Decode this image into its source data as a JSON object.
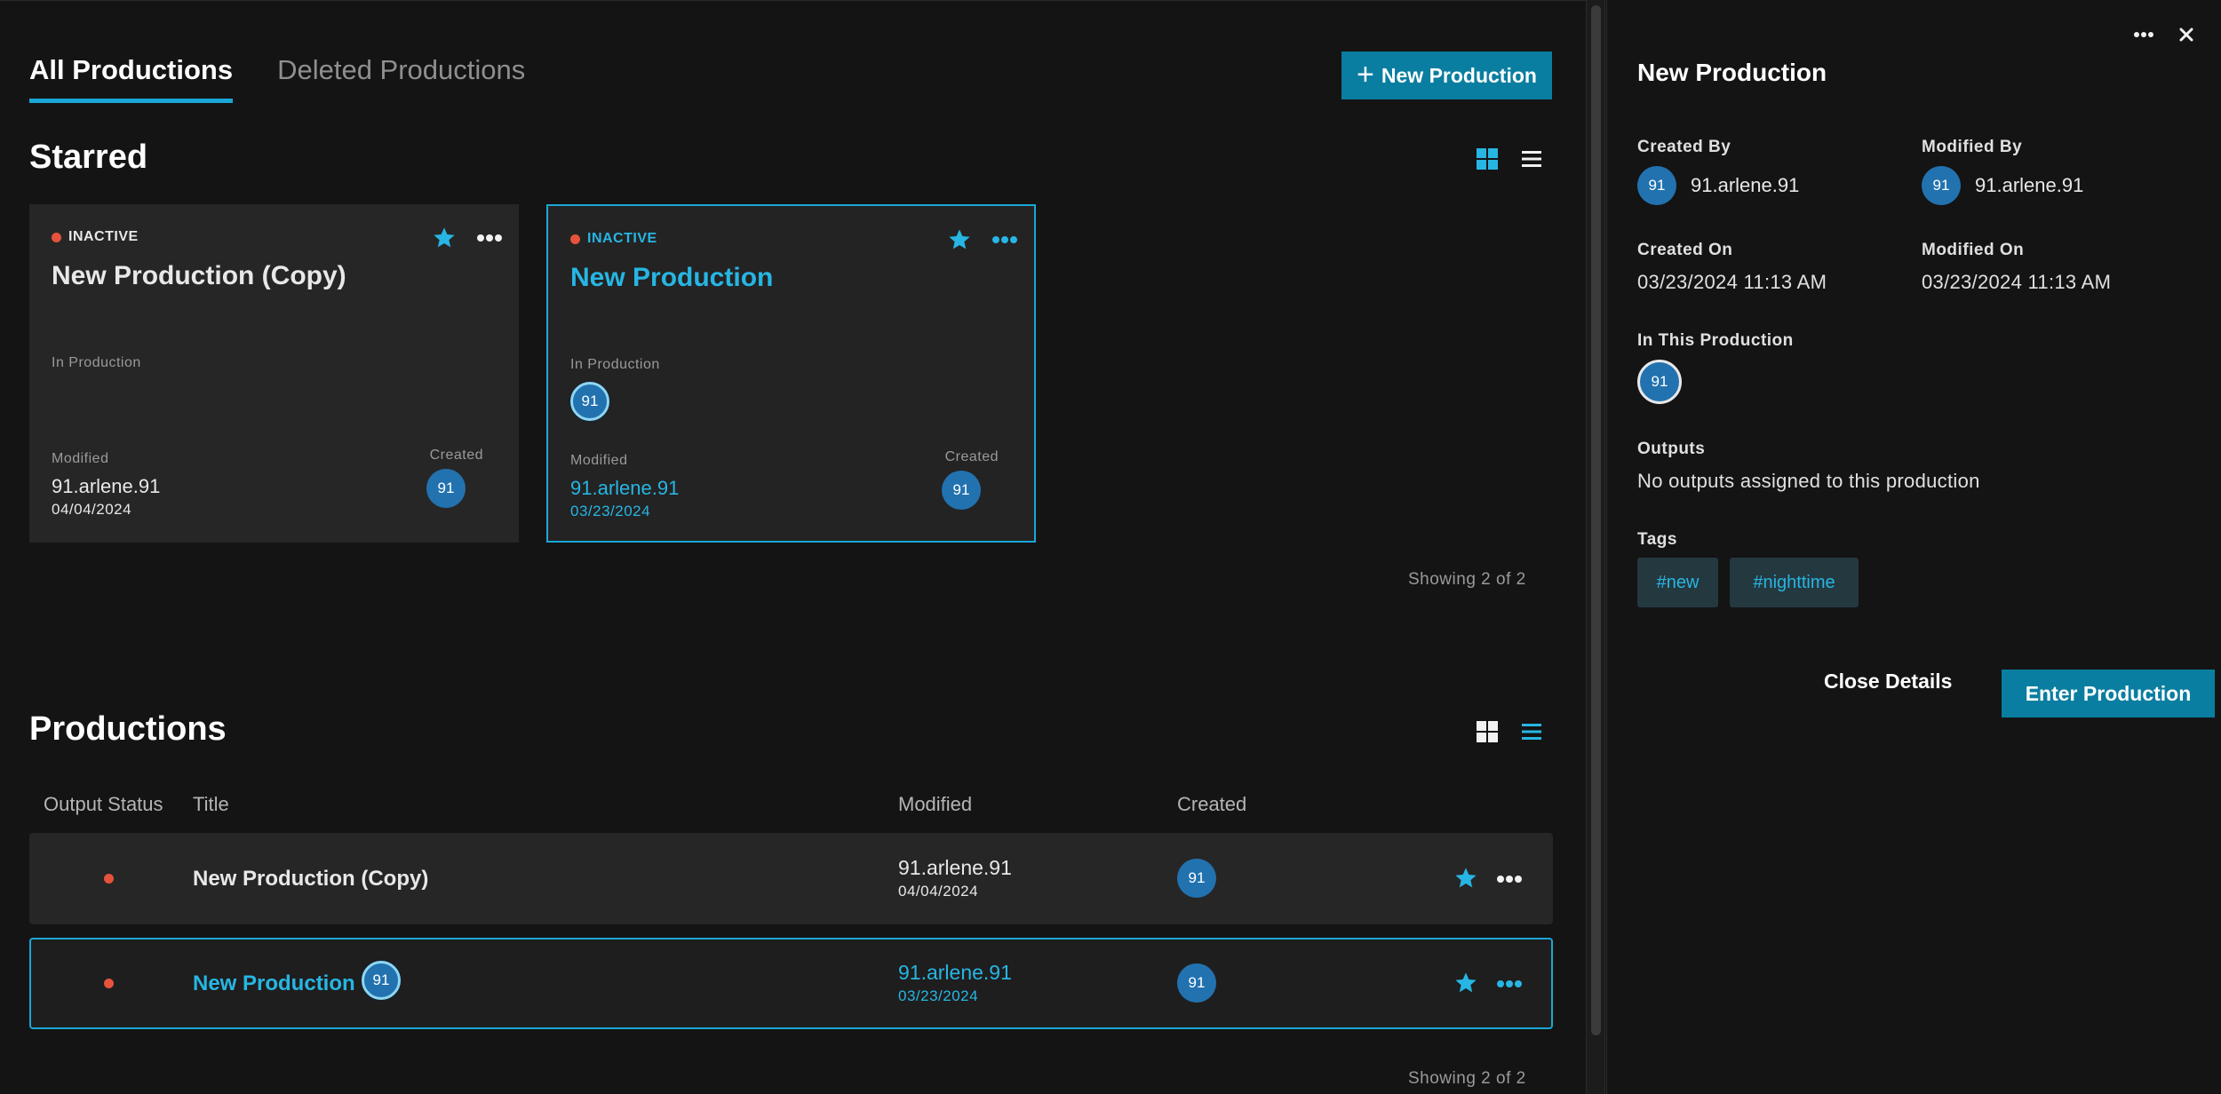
{
  "tabs": [
    {
      "label": "All Productions",
      "active": true
    },
    {
      "label": "Deleted Productions",
      "active": false
    }
  ],
  "new_production_button": {
    "label": "New Production",
    "icon": "plus-icon"
  },
  "starred": {
    "title": "Starred",
    "view": "grid",
    "cards": [
      {
        "status": "INACTIVE",
        "title": "New Production (Copy)",
        "starred": true,
        "in_production_label": "In Production",
        "in_production_members": [],
        "modified_label": "Modified",
        "modified_by": "91.arlene.91",
        "modified_date": "04/04/2024",
        "created_label": "Created",
        "created_avatar": "91",
        "selected": false
      },
      {
        "status": "INACTIVE",
        "title": "New Production",
        "starred": true,
        "in_production_label": "In Production",
        "in_production_members": [
          "91"
        ],
        "modified_label": "Modified",
        "modified_by": "91.arlene.91",
        "modified_date": "03/23/2024",
        "created_label": "Created",
        "created_avatar": "91",
        "selected": true
      }
    ],
    "showing": "Showing 2 of 2"
  },
  "productions": {
    "title": "Productions",
    "view": "list",
    "columns": [
      "Output Status",
      "Title",
      "Modified",
      "Created"
    ],
    "rows": [
      {
        "title": "New Production (Copy)",
        "member_avatar": "",
        "modified_by": "91.arlene.91",
        "modified_date": "04/04/2024",
        "created_avatar": "91",
        "selected": false
      },
      {
        "title": "New Production",
        "member_avatar": "91",
        "modified_by": "91.arlene.91",
        "modified_date": "03/23/2024",
        "created_avatar": "91",
        "selected": true
      }
    ],
    "showing": "Showing 2 of 2"
  },
  "details": {
    "title": "New Production",
    "created_by_label": "Created By",
    "created_by": "91.arlene.91",
    "created_by_avatar": "91",
    "modified_by_label": "Modified By",
    "modified_by": "91.arlene.91",
    "modified_by_avatar": "91",
    "created_on_label": "Created On",
    "created_on": "03/23/2024 11:13 AM",
    "modified_on_label": "Modified On",
    "modified_on": "03/23/2024 11:13 AM",
    "in_this_production_label": "In This Production",
    "in_this_production_avatar": "91",
    "outputs_label": "Outputs",
    "outputs_value": "No outputs assigned to this production",
    "tags_label": "Tags",
    "tags": [
      "#new",
      "#nighttime"
    ],
    "close_label": "Close Details",
    "enter_label": "Enter Production"
  },
  "colors": {
    "accent": "#1aa7d8",
    "accent_text": "#27b6e3",
    "button": "#0a7ea0",
    "inactive_dot": "#e5533d",
    "avatar": "#2272b0"
  }
}
